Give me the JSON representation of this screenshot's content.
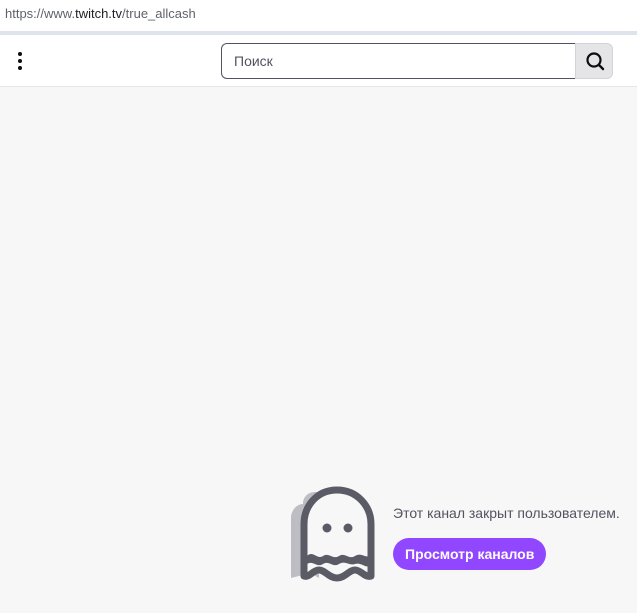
{
  "browser": {
    "url_prefix": "https://www.",
    "url_domain": "twitch.tv",
    "url_path": "/true_allcash"
  },
  "topnav": {
    "more_icon": "vertical-dots-icon",
    "search": {
      "placeholder": "Поиск",
      "value": "",
      "button_icon": "search-icon"
    }
  },
  "main": {
    "illustration_icon": "ghost-icon",
    "message": "Этот канал закрыт пользователем.",
    "browse_button_label": "Просмотр каналов"
  },
  "colors": {
    "accent": "#9147ff",
    "background": "#f7f7f8",
    "text_muted": "#53535f"
  }
}
